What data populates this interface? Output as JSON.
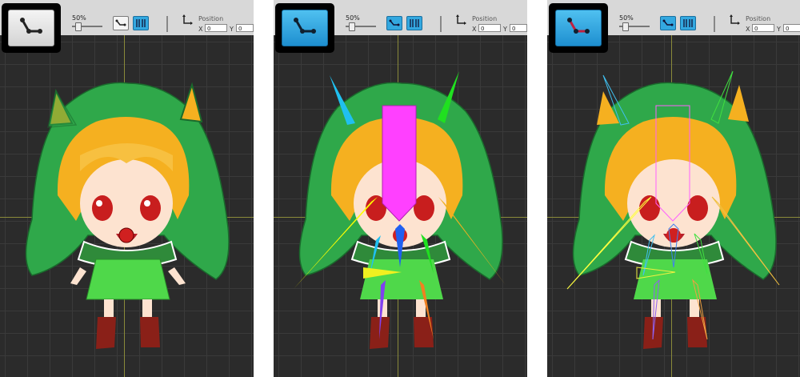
{
  "panels": [
    {
      "name": "panel-default",
      "zoom": "50%",
      "position_label": "Position",
      "x_label": "X",
      "x_value": "0",
      "y_label": "Y",
      "y_value": "0",
      "bone_tool_state": "off",
      "mode": "default"
    },
    {
      "name": "panel-bones",
      "zoom": "50%",
      "position_label": "Position",
      "x_label": "X",
      "x_value": "0",
      "y_label": "Y",
      "y_value": "0",
      "bone_tool_state": "on",
      "mode": "bones"
    },
    {
      "name": "panel-skeleton",
      "zoom": "50%",
      "position_label": "Position",
      "x_label": "X",
      "x_value": "0",
      "y_label": "Y",
      "y_value": "0",
      "bone_tool_state": "on",
      "mode": "skeleton"
    }
  ],
  "icons": {
    "bone_tool": "bone-tool-icon",
    "mode_a": "bone-chain-icon",
    "mode_b": "mesh-icon",
    "position": "move-axes-icon"
  },
  "colors": {
    "accent": "#33a8e0",
    "canvas": "#2b2b2b",
    "grid": "#3a3a3a",
    "axis": "#8a8a3a",
    "hood": "#2fa84a",
    "dress": "#4fd84a",
    "hair": "#f5b020",
    "boots": "#8a2018",
    "bone_pink": "#ff40ff",
    "bone_yellow": "#ffff00",
    "bone_cyan": "#20c0f0",
    "bone_green": "#20e020",
    "bone_orange": "#f0a020"
  }
}
